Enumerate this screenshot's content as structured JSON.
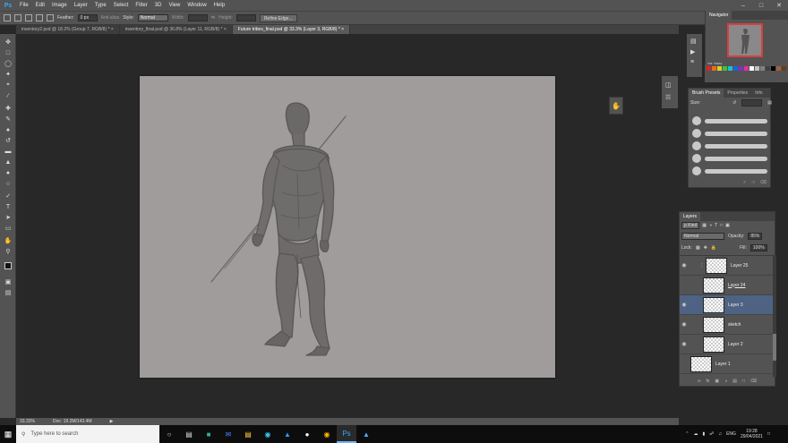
{
  "app": {
    "logo": "Ps"
  },
  "menu": [
    "File",
    "Edit",
    "Image",
    "Layer",
    "Type",
    "Select",
    "Filter",
    "3D",
    "View",
    "Window",
    "Help"
  ],
  "options_bar": {
    "feather_label": "Feather:",
    "feather_value": "0 px",
    "anti_alias_label": "Anti-alias",
    "style_label": "Style:",
    "style_value": "Normal",
    "width_label": "Width:",
    "height_label": "Height:",
    "refine_edge_label": "Refine Edge..."
  },
  "tabs": [
    {
      "label": "inventory2.psd @ 18.2% (Group 7, RGB/8) *",
      "active": false
    },
    {
      "label": "inventory_final.psd @ 36.8% (Layer 11, RGB/8) *",
      "active": false
    },
    {
      "label": "Future tribes_final.psd @ 33.3% (Layer 3, RGB/8) *",
      "active": true
    }
  ],
  "status": {
    "zoom": "33.33%",
    "doc": "Doc: 19.2M/143.4M"
  },
  "navigator": {
    "tab": "Navigator",
    "zoom": "33.33%"
  },
  "brush_panel": {
    "tabs": [
      "Brush Presets",
      "Properties",
      "Info"
    ],
    "size_label": "Size:"
  },
  "layers_panel": {
    "tab": "Layers",
    "filter_value": "ρ Kind",
    "blend_mode": "Normal",
    "opacity_label": "Opacity:",
    "opacity_value": "85%",
    "lock_label": "Lock:",
    "fill_label": "Fill:",
    "fill_value": "100%",
    "layers": [
      {
        "name": "Layer 25",
        "selected": false
      },
      {
        "name": "Layer 24",
        "selected": false
      },
      {
        "name": "Layer 3",
        "selected": true
      },
      {
        "name": "sketch",
        "selected": false
      },
      {
        "name": "Layer 2",
        "selected": false
      },
      {
        "name": "Layer 1",
        "selected": false
      }
    ]
  },
  "taskbar": {
    "search_placeholder": "Type here to search",
    "language": "ENG",
    "time": "19:28",
    "date": "29/04/2021"
  },
  "colors": {
    "canvas_bg": "#a09c9b",
    "accent": "#31a8ff",
    "selected_layer": "#4e6383"
  }
}
